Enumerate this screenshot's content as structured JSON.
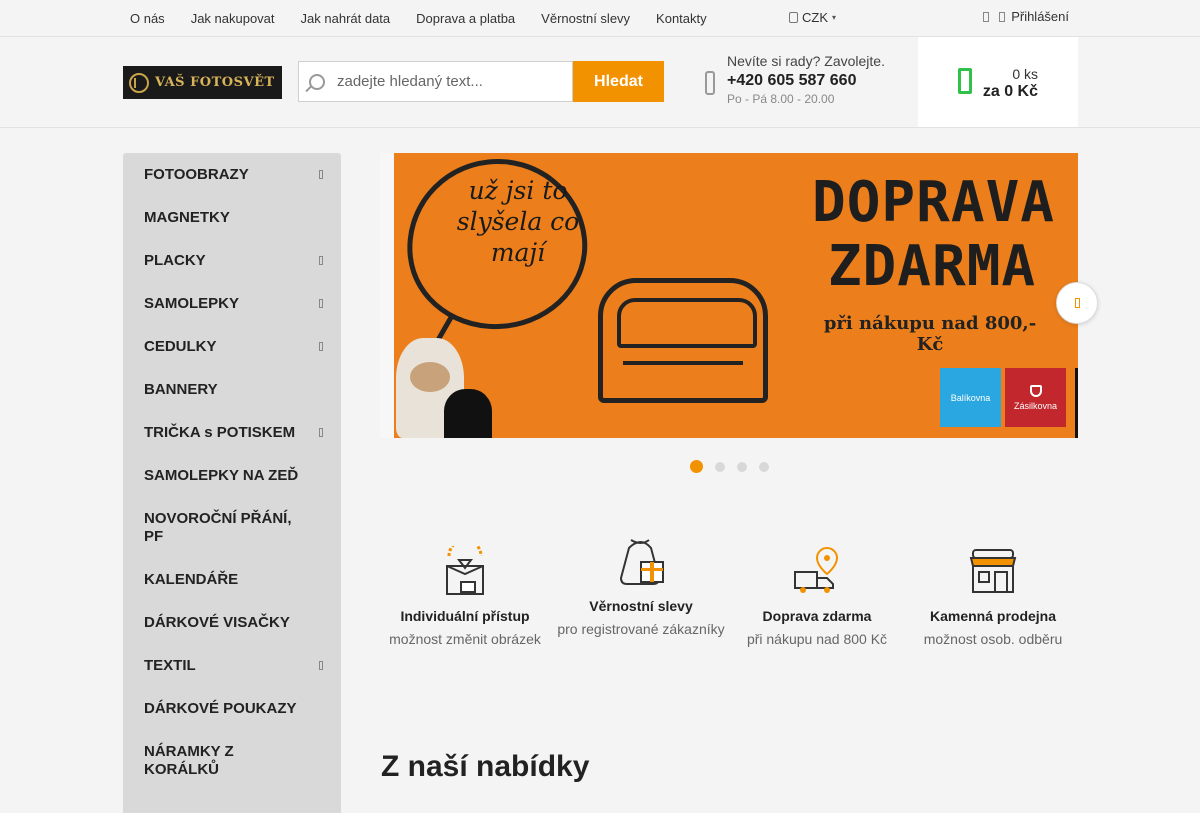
{
  "topbar": {
    "nav": [
      "O nás",
      "Jak nakupovat",
      "Jak nahrát data",
      "Doprava a platba",
      "Věrnostní slevy",
      "Kontakty"
    ],
    "currency": "CZK",
    "login": "Přihlášení"
  },
  "header": {
    "logo_text": "VAŠ FOTOSVĚT",
    "search": {
      "placeholder": "zadejte hledaný text...",
      "button": "Hledat"
    },
    "contact": {
      "question": "Nevíte si rady? Zavolejte.",
      "phone": "+420 605 587 660",
      "hours": "Po - Pá 8.00 - 20.00"
    },
    "cart": {
      "qty": "0 ks",
      "sum": "za 0 Kč"
    }
  },
  "sidebar": {
    "items": [
      {
        "label": "FOTOOBRAZY",
        "submenu": true
      },
      {
        "label": "MAGNETKY",
        "submenu": false
      },
      {
        "label": "PLACKY",
        "submenu": true
      },
      {
        "label": "SAMOLEPKY",
        "submenu": true
      },
      {
        "label": "CEDULKY",
        "submenu": true
      },
      {
        "label": "BANNERY",
        "submenu": false
      },
      {
        "label": "TRIČKA s POTISKEM",
        "submenu": true
      },
      {
        "label": "SAMOLEPKY NA ZEĎ",
        "submenu": false
      },
      {
        "label": "NOVOROČNÍ PŘÁNÍ, PF",
        "submenu": false
      },
      {
        "label": "KALENDÁŘE",
        "submenu": false
      },
      {
        "label": "DÁRKOVÉ VISAČKY",
        "submenu": false
      },
      {
        "label": "TEXTIL",
        "submenu": true
      },
      {
        "label": "DÁRKOVÉ POUKAZY",
        "submenu": false
      },
      {
        "label": "NÁRAMKY Z KORÁLKŮ",
        "submenu": false
      }
    ]
  },
  "banner": {
    "bubble_text": "už jsi to slyšela co mají",
    "title": "DOPRAVA ZDARMA",
    "subtitle": "při nákupu nad 800,- Kč",
    "partner_1": "Balíkovna",
    "partner_2": "Zásilkovna",
    "slides": 4,
    "active_slide": 1
  },
  "benefits": [
    {
      "title": "Individuální přístup",
      "subtitle": "možnost změnit obrázek",
      "icon": "box-heart-icon"
    },
    {
      "title": "Věrnostní slevy",
      "subtitle": "pro registrované zákazníky",
      "icon": "gift-bag-icon"
    },
    {
      "title": "Doprava zdarma",
      "subtitle": "při nákupu nad 800 Kč",
      "icon": "delivery-truck-icon"
    },
    {
      "title": "Kamenná prodejna",
      "subtitle": "možnost osob. odběru",
      "icon": "storefront-icon"
    }
  ],
  "section": {
    "title": "Z naší nabídky"
  },
  "colors": {
    "accent": "#f39200",
    "cart_green": "#2ec24a",
    "sidebar_bg": "#d9d9d9",
    "banner_orange": "#ec7f1c"
  }
}
